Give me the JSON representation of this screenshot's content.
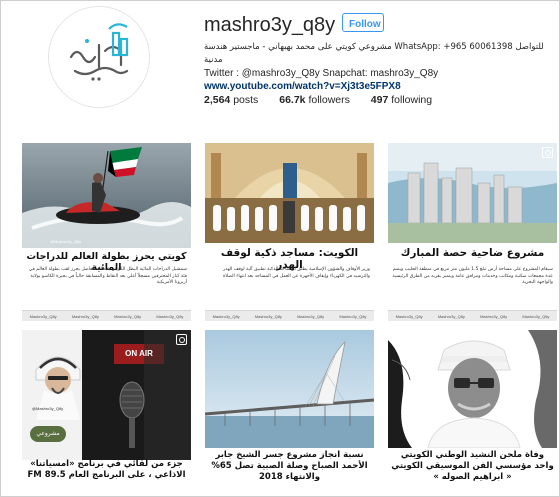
{
  "profile": {
    "username": "mashro3y_q8y",
    "follow_label": "Follow",
    "bio_line1_ar": "للتواصل WhatsApp: +965 60061398 مشروعي كويتي على محمد بهبهاني - ماجستير هندسة مدنية",
    "bio_line2": "Twitter : @mashro3y_Q8y Snapchat: mashro3y_Q8y",
    "bio_link": "www.youtube.com/watch?v=Xj3t3e5FPX8",
    "avatar_text": "مشروعي كويتي"
  },
  "stats": {
    "posts_count": "2,564",
    "posts_label": "posts",
    "followers_count": "66.7k",
    "followers_label": "followers",
    "following_count": "497",
    "following_label": "following"
  },
  "posts": [
    {
      "headline": "كويتي يحرز بطولة العالم للدراجات المائية",
      "body": "شمشيل الدراجات المائية البطل الكويتي عبدالله الفاضل يحرز لقب بطولة العالم في فئة كبار المحترفين مسجلاً أعلى بعد النقاط والمسابقة حالياً في بحيرة الكاسو بولاية أريزونا الأمريكية",
      "tags": [
        "Mashro3y_Q8y",
        "Mashro3y_Q8y",
        "Mashro3y_Q8y",
        "Mashro3y_Q8y"
      ],
      "handle": "@Mashro3y_Q8y"
    },
    {
      "headline": "الكويت: مساجد ذكية لوقف الهدر",
      "body": "وزير الأوقاف والشؤون الإسلامية يطلق المساجد الذكية تطبيق آلية لوقف الهدر والترشيد في الكهرباء وإيقاف الأجهزة عن العمل في المساجد بعد انتهاء الصلاة",
      "tags": [
        "Mashro3y_Q8y",
        "Mashro3y_Q8y",
        "Mashro3y_Q8y",
        "Mashro3y_Q8y"
      ],
      "handle": ""
    },
    {
      "headline": "مشروع ضاحية حصة المبارك",
      "body": "سيقام المشروع على مساحة أرض تبلغ 1.5 مليون متر مربع في منطقة الجليب ويضم عدة مجمعات سكنية ومكاتب وخدمات ومرافق عامة ويتميز بقربه من الطرق الرئيسية والواجهة البحرية",
      "tags": [
        "Mashro3y_Q8y",
        "Mashro3y_Q8y",
        "Mashro3y_Q8y",
        "Mashro3y_Q8y"
      ],
      "handle": ""
    },
    {
      "headline": "جزء من لقائي في برنامج «امسياتنا» الاذاعي ، على البرنامج العام FM 89.5",
      "on_air": "ON AIR",
      "logo_text": "مشروعي",
      "handle": "@Mashro3y_Q8y"
    },
    {
      "headline": "نسبة انجاز مشروع جسر الشيخ جابر الأحمد الصباح وصلة الصبية تصل 65% والانتهاء 2018",
      "handle": ""
    },
    {
      "headline": "وفاة ملحن النشيد الوطني الكويتي واحد مؤسسي الفن الموسيقي الكويتي « ابراهيم الصوله »",
      "handle": ""
    }
  ],
  "colors": {
    "follow_blue": "#3897f0",
    "link_blue": "#003569",
    "kuwait_green": "#007a3d",
    "kuwait_red": "#ce1126"
  }
}
